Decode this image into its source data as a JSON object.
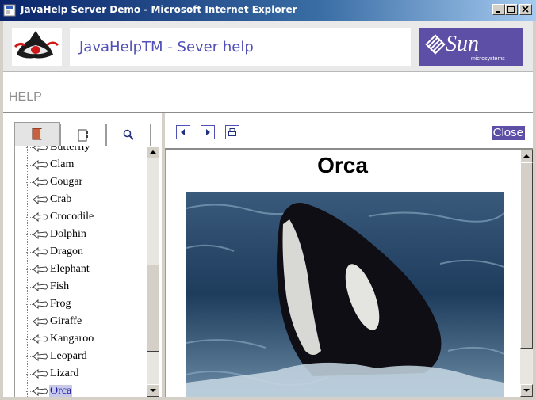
{
  "window": {
    "title": "JavaHelp Server Demo - Microsoft Internet Explorer"
  },
  "banner": {
    "title": "JavaHelpTM - Sever help",
    "sun_logo_text": "Sun",
    "sun_logo_sub": "microsystems"
  },
  "help_label": "HELP",
  "tabs": [
    {
      "name": "contents",
      "icon": "book-icon",
      "active": true
    },
    {
      "name": "index",
      "icon": "index-icon",
      "active": false
    },
    {
      "name": "search",
      "icon": "search-icon",
      "active": false
    }
  ],
  "tree": {
    "items": [
      {
        "label": "Butterfly"
      },
      {
        "label": "Clam"
      },
      {
        "label": "Cougar"
      },
      {
        "label": "Crab"
      },
      {
        "label": "Crocodile"
      },
      {
        "label": "Dolphin"
      },
      {
        "label": "Dragon"
      },
      {
        "label": "Elephant"
      },
      {
        "label": "Fish"
      },
      {
        "label": "Frog"
      },
      {
        "label": "Giraffe"
      },
      {
        "label": "Kangaroo"
      },
      {
        "label": "Leopard"
      },
      {
        "label": "Lizard"
      },
      {
        "label": "Orca"
      }
    ],
    "selected": "Orca"
  },
  "toolbar": {
    "close_label": "Close"
  },
  "document": {
    "title": "Orca"
  },
  "colors": {
    "accent": "#5c4fa5",
    "link": "#5050b8",
    "titlebar": "#0a246a"
  }
}
